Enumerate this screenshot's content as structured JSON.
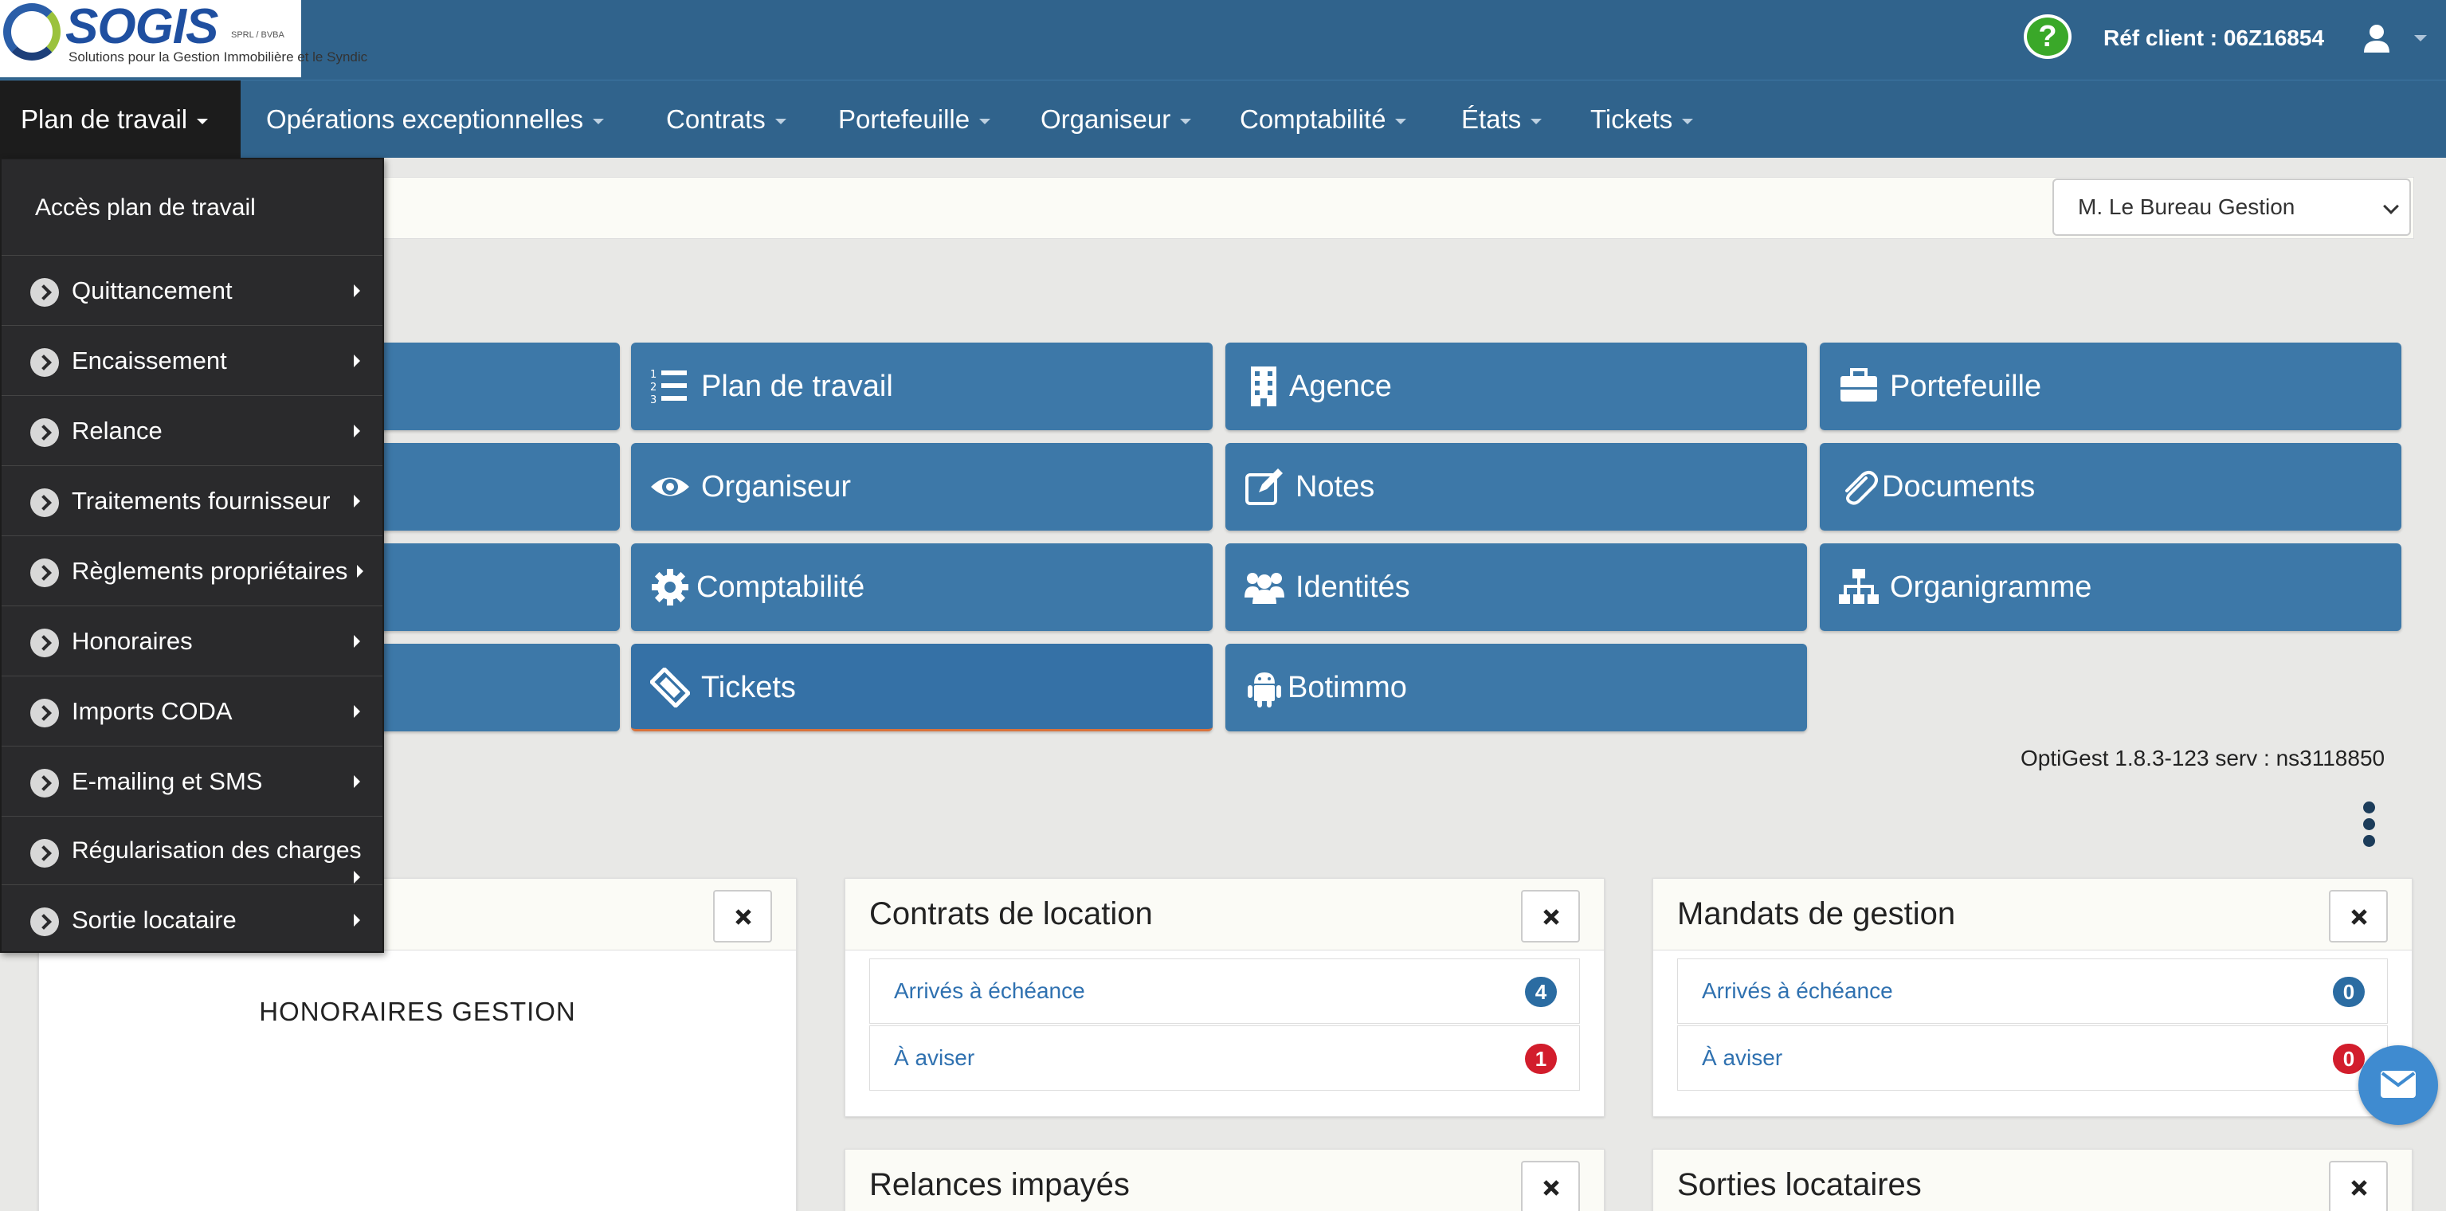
{
  "header": {
    "logo_text": "SOGIS",
    "logo_legal": "SPRL / BVBA",
    "logo_tagline": "Solutions pour la Gestion Immobilière et le Syndic",
    "ref_client": "Réf client : 06Z16854"
  },
  "nav": [
    {
      "label": "Plan de travail"
    },
    {
      "label": "Opérations exceptionnelles"
    },
    {
      "label": "Contrats"
    },
    {
      "label": "Portefeuille"
    },
    {
      "label": "Organiseur"
    },
    {
      "label": "Comptabilité"
    },
    {
      "label": "États"
    },
    {
      "label": "Tickets"
    }
  ],
  "dropdown": {
    "header": "Accès plan de travail",
    "items": [
      {
        "label": "Quittancement"
      },
      {
        "label": "Encaissement"
      },
      {
        "label": "Relance"
      },
      {
        "label": "Traitements fournisseur"
      },
      {
        "label": "Règlements propriétaires"
      },
      {
        "label": "Honoraires"
      },
      {
        "label": "Imports CODA"
      },
      {
        "label": "E-mailing et SMS"
      },
      {
        "label": "Régularisation des charges"
      },
      {
        "label": "Sortie locataire"
      }
    ]
  },
  "filter": {
    "selected": "M. Le Bureau Gestion"
  },
  "tiles": [
    {
      "label": "Plan de travail",
      "icon": "list-ol-icon"
    },
    {
      "label": "Agence",
      "icon": "building-icon"
    },
    {
      "label": "Portefeuille",
      "icon": "briefcase-icon"
    },
    {
      "label": "Organiseur",
      "icon": "eye-icon"
    },
    {
      "label": "Notes",
      "icon": "edit-icon"
    },
    {
      "label": "Documents",
      "icon": "paperclip-icon"
    },
    {
      "label": "Comptabilité",
      "icon": "gear-icon"
    },
    {
      "label": "Identités",
      "icon": "users-icon"
    },
    {
      "label": "Organigramme",
      "icon": "sitemap-icon"
    },
    {
      "label": "Tickets",
      "icon": "ticket-icon"
    },
    {
      "label": "Botimmo",
      "icon": "android-icon"
    }
  ],
  "version": "OptiGest 1.8.3-123 serv : ns3118850",
  "panels": {
    "honoraires": {
      "title": "HONORAIRES GESTION"
    },
    "contrats": {
      "title": "Contrats de location",
      "rows": [
        {
          "label": "Arrivés à échéance",
          "count": "4"
        },
        {
          "label": "À aviser",
          "count": "1"
        }
      ]
    },
    "mandats": {
      "title": "Mandats de gestion",
      "rows": [
        {
          "label": "Arrivés à échéance",
          "count": "0"
        },
        {
          "label": "À aviser",
          "count": "0"
        }
      ]
    },
    "relances": {
      "title": "Relances impayés"
    },
    "sorties": {
      "title": "Sorties locataires"
    }
  },
  "colors": {
    "navbar": "#30638c",
    "tile": "#3d78a8",
    "dropdown": "#2a2a2c",
    "badge_blue": "#2b6ca2",
    "badge_red": "#d21d2c"
  }
}
